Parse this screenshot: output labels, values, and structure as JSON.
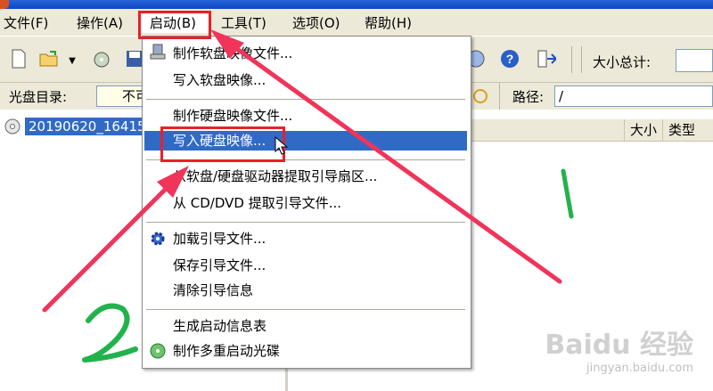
{
  "window": {
    "title": ""
  },
  "menubar": {
    "items": [
      {
        "label": "文件(F)"
      },
      {
        "label": "操作(A)"
      },
      {
        "label": "启动(B)"
      },
      {
        "label": "工具(T)"
      },
      {
        "label": "选项(O)"
      },
      {
        "label": "帮助(H)"
      }
    ]
  },
  "toolbar": {
    "size_total_label": "大小总计:",
    "size_total_value": ""
  },
  "addrbar": {
    "disc_dir_label": "光盘目录:",
    "disc_dir_value": "不可",
    "path_label": "路径:",
    "path_value": "/"
  },
  "tree": {
    "root_label": "20190620_16415"
  },
  "filelist": {
    "columns": [
      "大小",
      "类型"
    ]
  },
  "dropdown": {
    "items": [
      {
        "label": "制作软盘映像文件..."
      },
      {
        "label": "写入软盘映像..."
      },
      {
        "label": "制作硬盘映像文件..."
      },
      {
        "label": "写入硬盘映像..."
      },
      {
        "label": "从软盘/硬盘驱动器提取引导扇区..."
      },
      {
        "label": "从 CD/DVD 提取引导文件..."
      },
      {
        "label": "加载引导文件..."
      },
      {
        "label": "保存引导文件..."
      },
      {
        "label": "清除引导信息"
      },
      {
        "label": "生成启动信息表"
      },
      {
        "label": "制作多重启动光碟"
      }
    ]
  },
  "annotations": {
    "step1": "1",
    "step2": "2",
    "arrow_color": "#f0345a",
    "box_color": "#e8202a",
    "pen_color": "#22b24c"
  },
  "watermark": {
    "logo": "Baidu 经验",
    "url": "jingyan.baidu.com"
  }
}
